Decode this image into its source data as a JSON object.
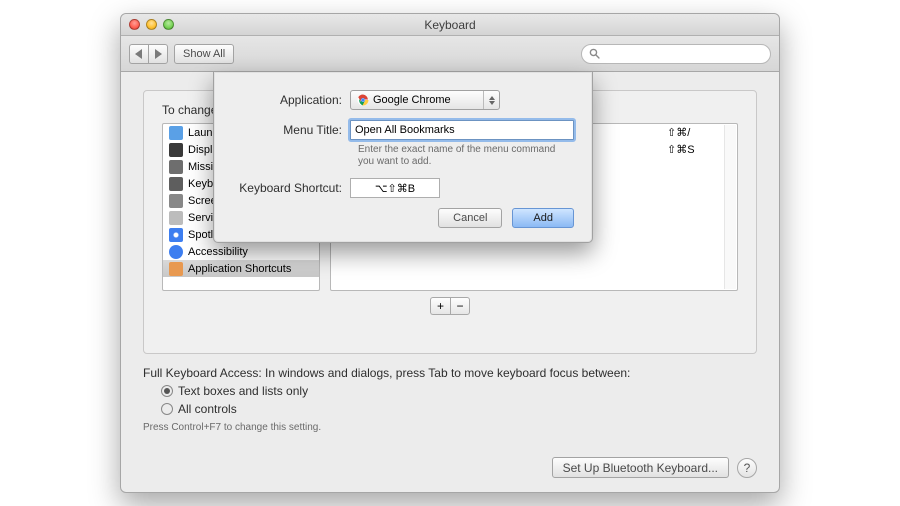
{
  "window": {
    "title": "Keyboard"
  },
  "toolbar": {
    "show_all": "Show All",
    "search_placeholder": ""
  },
  "group": {
    "change_text": "To change a s",
    "categories": {
      "items": [
        {
          "label": "Launchpad & Dock",
          "icon_color": "#5aa0e6"
        },
        {
          "label": "Display",
          "icon_color": "#3a3a3a"
        },
        {
          "label": "Mission C",
          "icon_color": "#6e6e6e"
        },
        {
          "label": "Keyboard & Text Input",
          "icon_color": "#5e5e5e"
        },
        {
          "label": "Screen Sh",
          "icon_color": "#888888"
        },
        {
          "label": "Services",
          "icon_color": "#bcbcbc"
        },
        {
          "label": "Spotlight",
          "icon_color": "#3d7ef0"
        },
        {
          "label": "Accessibility",
          "icon_color": "#3d7ef0"
        }
      ],
      "selected": {
        "label": "Application Shortcuts",
        "icon_color": "#c27a3b"
      }
    },
    "shortlist": {
      "items": [
        {
          "combo": "⇧⌘/"
        },
        {
          "combo": "⇧⌘S"
        }
      ]
    }
  },
  "below": {
    "full_access": "Full Keyboard Access: In windows and dialogs, press Tab to move keyboard focus between:",
    "radio1": "Text boxes and lists only",
    "radio2": "All controls",
    "note": "Press Control+F7 to change this setting."
  },
  "footer": {
    "bt_button": "Set Up Bluetooth Keyboard..."
  },
  "sheet": {
    "app_label": "Application:",
    "app_value": "Google Chrome",
    "menu_label": "Menu Title:",
    "menu_value": "Open All Bookmarks",
    "hint": "Enter the exact name of the menu command you want to add.",
    "shortcut_label": "Keyboard Shortcut:",
    "shortcut_value": "⌥⇧⌘B",
    "cancel": "Cancel",
    "add": "Add"
  }
}
